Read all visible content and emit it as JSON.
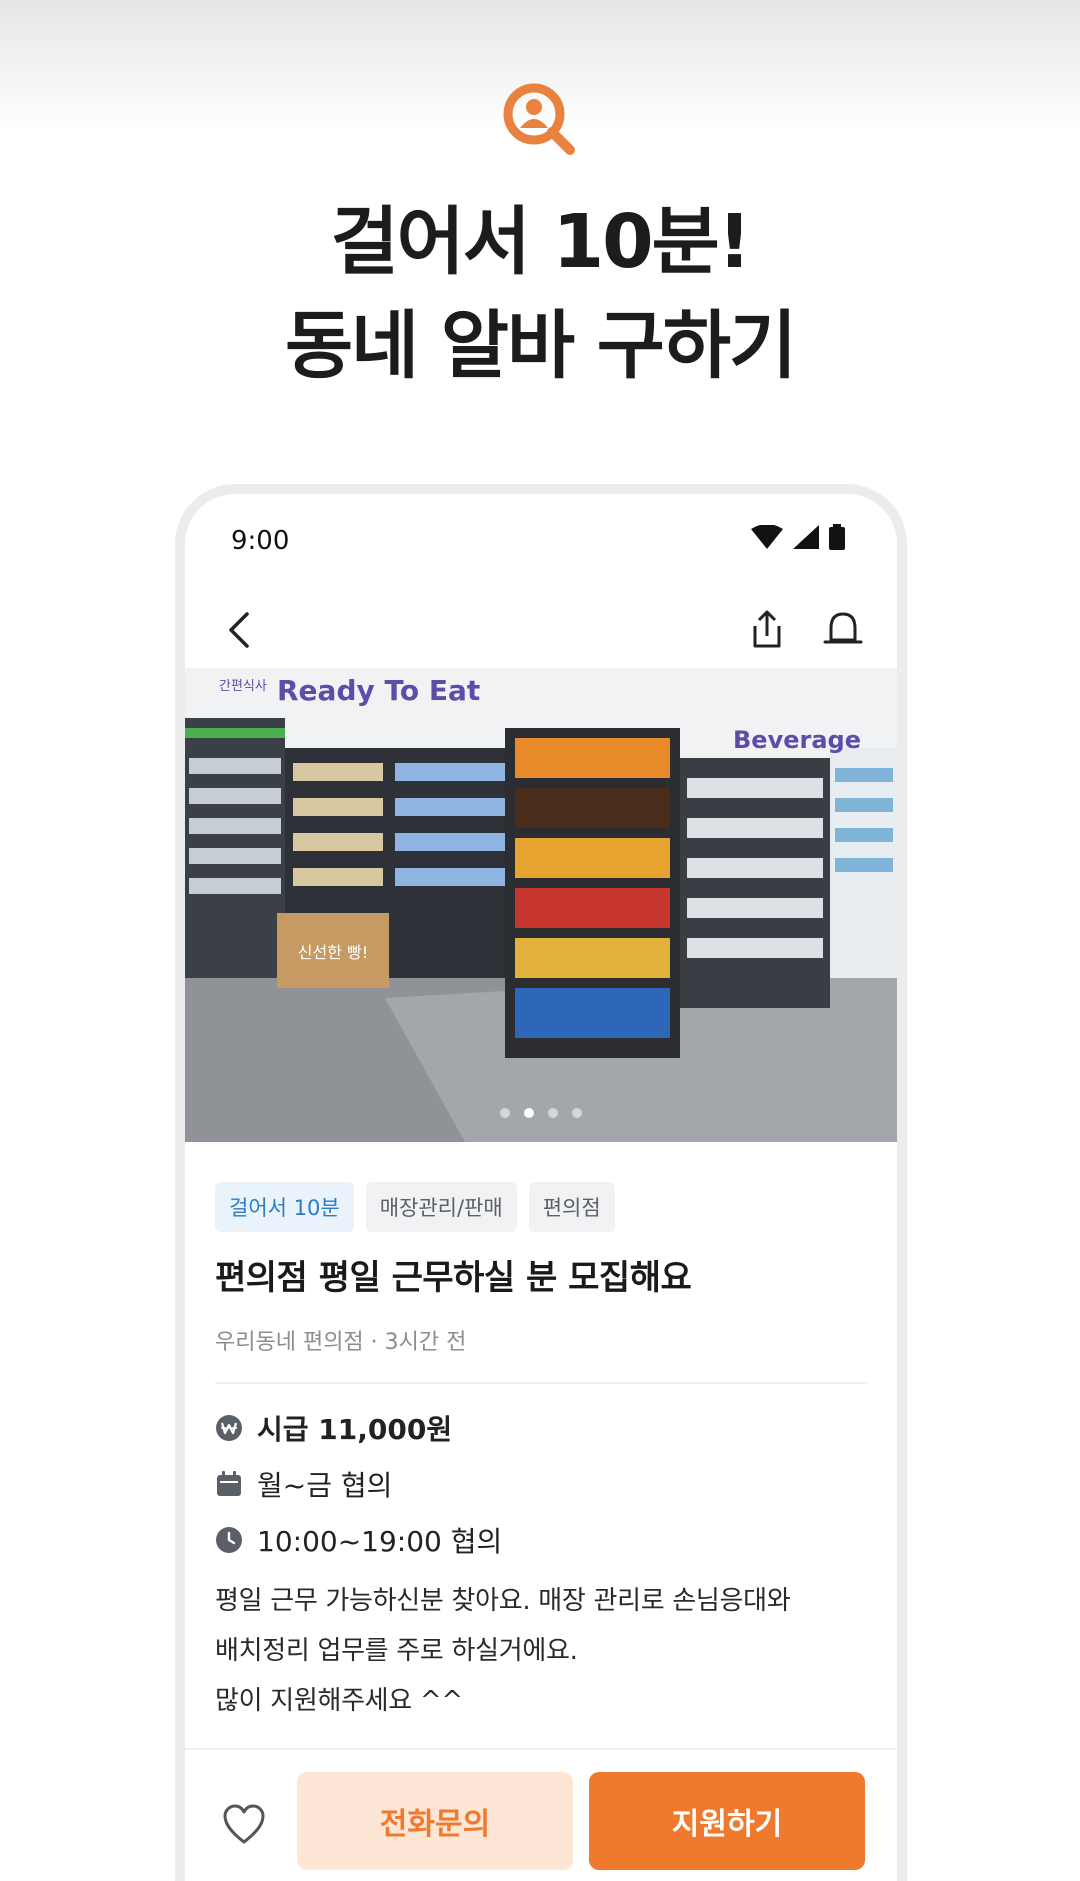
{
  "hero": {
    "icon": "search-person-icon",
    "title_line1": "걸어서 10분!",
    "title_line2": "동네 알바 구하기"
  },
  "status_bar": {
    "time": "9:00",
    "icons": [
      "wifi-icon",
      "signal-icon",
      "battery-icon"
    ]
  },
  "app_bar": {
    "back_icon": "chevron-left-icon",
    "share_icon": "share-icon",
    "alarm_icon": "alarm-bell-icon"
  },
  "photo": {
    "sign_left_small": "간편식사",
    "sign_left": "Ready To Eat",
    "sign_right": "Beverage",
    "counter_text": "신선한 빵!",
    "carousel_total": 4,
    "carousel_active": 2
  },
  "post": {
    "tags": [
      "걸어서 10분",
      "매장관리/판매",
      "편의점"
    ],
    "title": "편의점 평일 근무하실 분 모집해요",
    "meta": "우리동네 편의점 · 3시간 전",
    "wage": "시급 11,000원",
    "days": "월~금 협의",
    "hours": "10:00~19:00 협의",
    "description": "평일 근무 가능하신분 찾아요. 매장 관리로 손님응대와\n배치정리 업무를 주로 하실거에요.\n많이 지원해주세요 ^^"
  },
  "actions": {
    "like_icon": "heart-outline-icon",
    "call_label": "전화문의",
    "apply_label": "지원하기"
  },
  "colors": {
    "accent": "#ef7a2e",
    "accent_light": "#fde6d6",
    "tag_blue_bg": "#eaf3fb",
    "tag_blue_text": "#2c7bc4"
  }
}
